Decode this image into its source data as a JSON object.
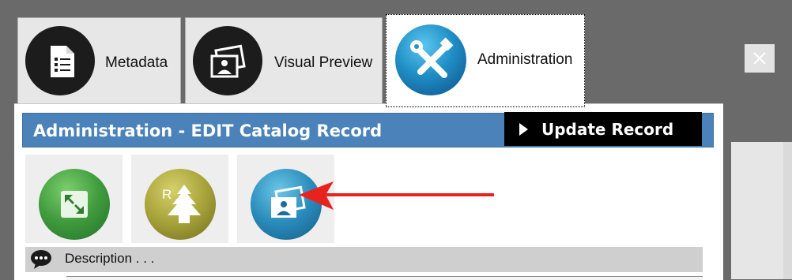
{
  "tabs": [
    {
      "label": "Metadata",
      "icon": "document-list-icon"
    },
    {
      "label": "Visual Preview",
      "icon": "photo-person-icon"
    },
    {
      "label": "Administration",
      "icon": "tools-icon"
    }
  ],
  "header": {
    "title": "Administration - EDIT Catalog Record",
    "update_label": "Update Record"
  },
  "toolbar": [
    {
      "icon": "expand-icon",
      "color": "#3f9a3d"
    },
    {
      "icon": "pine-tree-r-icon",
      "color": "#a7a33a"
    },
    {
      "icon": "photo-person-icon",
      "color": "#2a8cbc"
    }
  ],
  "description": {
    "label": "Description . . ."
  },
  "annotation": {
    "color": "#e8221e",
    "icon": "red-arrow-icon"
  }
}
